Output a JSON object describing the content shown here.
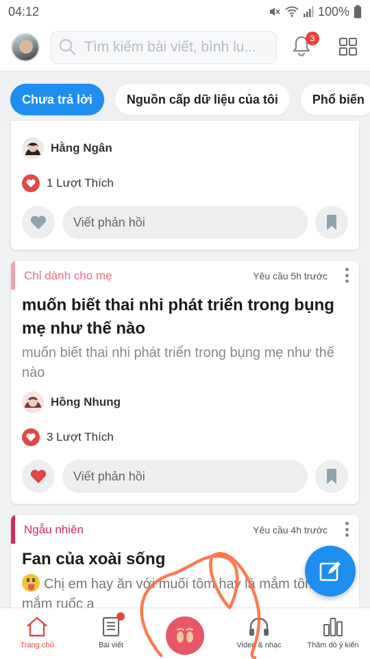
{
  "status_bar": {
    "time": "04:12",
    "battery": "100%"
  },
  "header": {
    "search_placeholder": "Tìm kiếm bài viết, bình lu...",
    "notification_count": "3"
  },
  "tabs": [
    {
      "label": "Chưa trả lời",
      "active": true
    },
    {
      "label": "Nguồn cấp dữ liệu của tôi",
      "active": false
    },
    {
      "label": "Phổ biến",
      "active": false
    }
  ],
  "posts": [
    {
      "author": "Hằng Ngân",
      "likes": "1 Lượt Thích",
      "reply_placeholder": "Viết phản hồi"
    },
    {
      "category": "Chỉ dành cho mẹ",
      "category_color": "#f26b84",
      "meta": "Yêu cầu 5h trước",
      "title": "muốn biết thai nhi phát triển trong bụng mẹ như thế nào",
      "body": "muốn biết thai nhi phát triển trong bụng mẹ như thế nào",
      "author": "Hồng Nhung",
      "likes": "3 Lượt Thích",
      "reply_placeholder": "Viết phản hồi"
    },
    {
      "category": "Ngẫu nhiên",
      "category_color": "#d6285c",
      "meta": "Yêu cầu 4h trước",
      "title": "Fan của xoài sống",
      "body": "Chị em hay ăn với muối tôm hay là mắm tôm, mắm ruốc ạ"
    }
  ],
  "bottom_nav": [
    {
      "label": "Trang chủ",
      "icon": "home-icon",
      "active": true
    },
    {
      "label": "Bài viết",
      "icon": "document-icon",
      "active": false
    },
    {
      "label": "",
      "icon": "footprints-icon",
      "active": false
    },
    {
      "label": "Video & nhạc",
      "icon": "headphones-icon",
      "active": false
    },
    {
      "label": "Thăm dò ý kiến",
      "icon": "bar-chart-icon",
      "active": false
    }
  ],
  "colors": {
    "primary": "#1f8ef1",
    "accent": "#e8443a",
    "annotation": "#ff6a3d"
  }
}
